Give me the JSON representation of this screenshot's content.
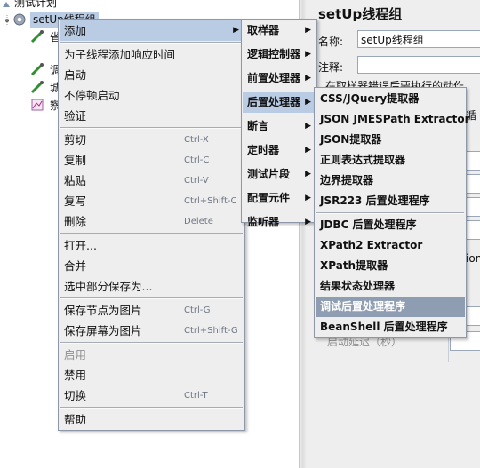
{
  "tree": {
    "root_label": "测试计划",
    "selected_label": "setUp线程组",
    "child_labels": [
      "省",
      "调",
      "城",
      "察"
    ]
  },
  "right_panel": {
    "title": "setUp线程组",
    "name_label": "名称:",
    "name_value": "setUp线程组",
    "comment_label": "注释:",
    "comment_value": "",
    "partial_text_1": "在取样器错误后要执行的动作",
    "partial_text_2": "循",
    "partial_text_3": "ation",
    "partial_text_4": "启动延迟（秒）"
  },
  "context_menu": {
    "items": [
      {
        "label": "添加",
        "shortcut": "",
        "state": "selected",
        "submenu": true
      },
      {
        "separator": true
      },
      {
        "label": "为子线程添加响应时间",
        "shortcut": ""
      },
      {
        "label": "启动",
        "shortcut": ""
      },
      {
        "label": "不停顿启动",
        "shortcut": ""
      },
      {
        "label": "验证",
        "shortcut": ""
      },
      {
        "separator": true
      },
      {
        "label": "剪切",
        "shortcut": "Ctrl-X"
      },
      {
        "label": "复制",
        "shortcut": "Ctrl-C"
      },
      {
        "label": "粘贴",
        "shortcut": "Ctrl-V"
      },
      {
        "label": "复写",
        "shortcut": "Ctrl+Shift-C"
      },
      {
        "label": "删除",
        "shortcut": "Delete"
      },
      {
        "separator": true
      },
      {
        "label": "打开...",
        "shortcut": ""
      },
      {
        "label": "合并",
        "shortcut": ""
      },
      {
        "label": "选中部分保存为...",
        "shortcut": ""
      },
      {
        "separator": true
      },
      {
        "label": "保存节点为图片",
        "shortcut": "Ctrl-G"
      },
      {
        "label": "保存屏幕为图片",
        "shortcut": "Ctrl+Shift-G"
      },
      {
        "separator": true
      },
      {
        "label": "启用",
        "shortcut": "",
        "state": "disabled"
      },
      {
        "label": "禁用",
        "shortcut": ""
      },
      {
        "label": "切换",
        "shortcut": "Ctrl-T"
      },
      {
        "separator": true
      },
      {
        "label": "帮助",
        "shortcut": ""
      }
    ]
  },
  "add_submenu": {
    "items": [
      {
        "label": "取样器",
        "submenu": true
      },
      {
        "label": "逻辑控制器",
        "submenu": true
      },
      {
        "label": "前置处理器",
        "submenu": true
      },
      {
        "label": "后置处理器",
        "submenu": true,
        "state": "selected"
      },
      {
        "label": "断言",
        "submenu": true
      },
      {
        "label": "定时器",
        "submenu": true
      },
      {
        "label": "测试片段",
        "submenu": true
      },
      {
        "label": "配置元件",
        "submenu": true
      },
      {
        "label": "监听器",
        "submenu": true
      }
    ]
  },
  "post_processor_submenu": {
    "items": [
      {
        "label": "CSS/JQuery提取器"
      },
      {
        "label": "JSON JMESPath Extractor"
      },
      {
        "label": "JSON提取器"
      },
      {
        "label": "正则表达式提取器"
      },
      {
        "label": "边界提取器"
      },
      {
        "label": "JSR223 后置处理程序"
      },
      {
        "separator": true
      },
      {
        "label": "JDBC 后置处理程序"
      },
      {
        "label": "XPath2 Extractor"
      },
      {
        "label": "XPath提取器"
      },
      {
        "label": "结果状态处理器"
      },
      {
        "label": "调试后置处理程序",
        "state": "highlighted"
      },
      {
        "label": "BeanShell 后置处理程序"
      }
    ]
  },
  "colors": {
    "menu_bg": "#eeeeee",
    "selected_bg": "#b9cce4",
    "highlight_bg": "#8e9db2",
    "shortcut_text": "#6e7684"
  }
}
